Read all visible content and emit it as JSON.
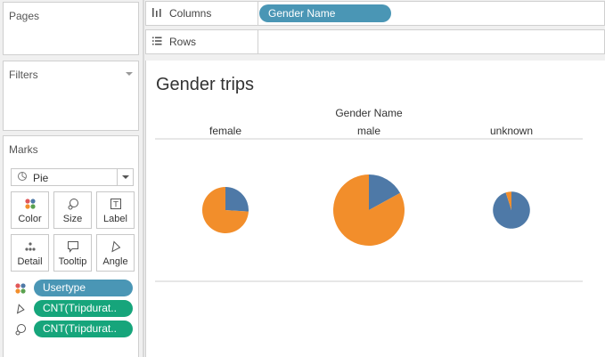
{
  "left": {
    "pages_title": "Pages",
    "filters_title": "Filters",
    "marks_title": "Marks",
    "mark_type": "Pie",
    "buttons": [
      {
        "label": "Color",
        "icon": "color-dots-icon"
      },
      {
        "label": "Size",
        "icon": "size-icon"
      },
      {
        "label": "Label",
        "icon": "label-icon"
      },
      {
        "label": "Detail",
        "icon": "detail-dots-icon"
      },
      {
        "label": "Tooltip",
        "icon": "tooltip-icon"
      },
      {
        "label": "Angle",
        "icon": "angle-icon"
      }
    ],
    "pills": [
      {
        "icon": "color-dots-icon",
        "label": "Usertype",
        "color": "blue"
      },
      {
        "icon": "angle-icon",
        "label": "CNT(Tripdurat..",
        "color": "green"
      },
      {
        "icon": "size-icon",
        "label": "CNT(Tripdurat..",
        "color": "green"
      }
    ]
  },
  "shelves": {
    "columns_label": "Columns",
    "columns_icon": "columns-icon",
    "columns_pill": "Gender Name",
    "rows_label": "Rows",
    "rows_icon": "rows-icon"
  },
  "colors": {
    "blue": "#4e79a7",
    "orange": "#f28e2b",
    "pill_blue": "#4a96b5",
    "pill_green": "#16a57b"
  },
  "view": {
    "title": "Gender trips",
    "header": "Gender Name"
  },
  "chart_data": {
    "type": "pie",
    "title": "Gender trips",
    "column_header": "Gender Name",
    "categories": [
      "female",
      "male",
      "unknown"
    ],
    "series_colors": [
      "#4e79a7",
      "#f28e2b"
    ],
    "pies": [
      {
        "category": "female",
        "relative_size": 0.65,
        "slices": [
          {
            "color": "#4e79a7",
            "fraction": 0.26
          },
          {
            "color": "#f28e2b",
            "fraction": 0.74
          }
        ]
      },
      {
        "category": "male",
        "relative_size": 1.0,
        "slices": [
          {
            "color": "#4e79a7",
            "fraction": 0.17
          },
          {
            "color": "#f28e2b",
            "fraction": 0.83
          }
        ]
      },
      {
        "category": "unknown",
        "relative_size": 0.52,
        "slices": [
          {
            "color": "#4e79a7",
            "fraction": 0.95
          },
          {
            "color": "#f28e2b",
            "fraction": 0.05
          }
        ]
      }
    ]
  }
}
